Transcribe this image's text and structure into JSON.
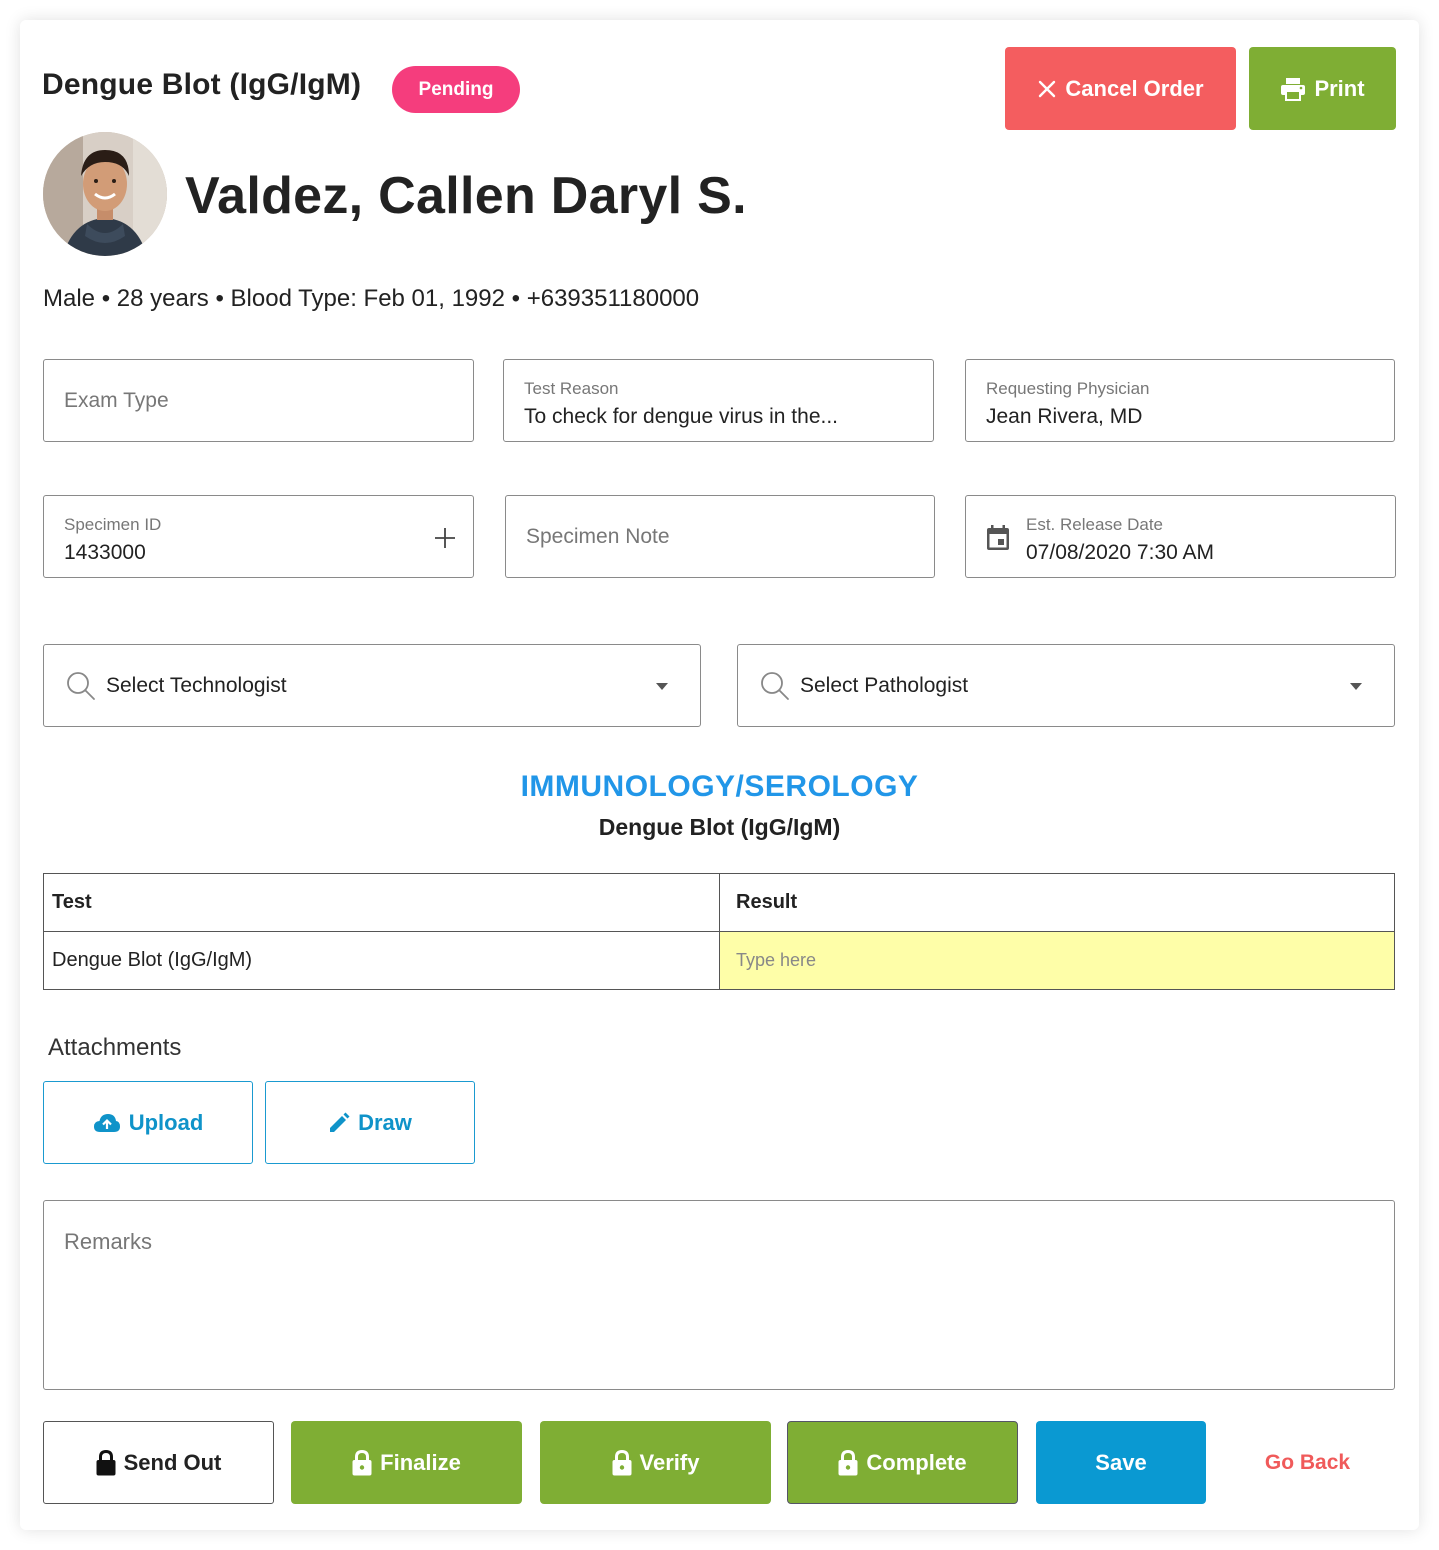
{
  "header": {
    "exam_title": "Dengue Blot (IgG/IgM)",
    "status": "Pending",
    "cancel_label": "Cancel Order",
    "print_label": "Print"
  },
  "patient": {
    "name": "Valdez, Callen Daryl S.",
    "meta": "Male • 28 years • Blood Type: Feb 01, 1992 • +639351180000"
  },
  "fields": {
    "exam_type": {
      "placeholder": "Exam Type"
    },
    "test_reason": {
      "label": "Test Reason",
      "value": "To check for dengue virus in the..."
    },
    "requesting_physician": {
      "label": "Requesting Physician",
      "value": "Jean Rivera, MD"
    },
    "specimen_id": {
      "label": "Specimen ID",
      "value": "1433000"
    },
    "specimen_note": {
      "placeholder": "Specimen Note"
    },
    "release_date": {
      "label": "Est. Release Date",
      "value": "07/08/2020 7:30 AM"
    }
  },
  "selects": {
    "technologist": "Select Technologist",
    "pathologist": "Select Pathologist"
  },
  "section": {
    "title": "IMMUNOLOGY/SEROLOGY",
    "subtitle": "Dengue Blot (IgG/IgM)"
  },
  "results_table": {
    "headers": [
      "Test",
      "Result"
    ],
    "rows": [
      {
        "test": "Dengue Blot (IgG/IgM)",
        "result_placeholder": "Type here"
      }
    ]
  },
  "attachments": {
    "label": "Attachments",
    "upload_label": "Upload",
    "draw_label": "Draw"
  },
  "remarks": {
    "placeholder": "Remarks"
  },
  "actions": {
    "send_out": "Send Out",
    "finalize": "Finalize",
    "verify": "Verify",
    "complete": "Complete",
    "save": "Save",
    "go_back": "Go Back"
  },
  "colors": {
    "pending_badge": "#f53d7d",
    "cancel": "#f45d5f",
    "green": "#7fae34",
    "save_blue": "#0a99d2",
    "section_blue": "#2196e8",
    "result_highlight": "#fefea8"
  }
}
